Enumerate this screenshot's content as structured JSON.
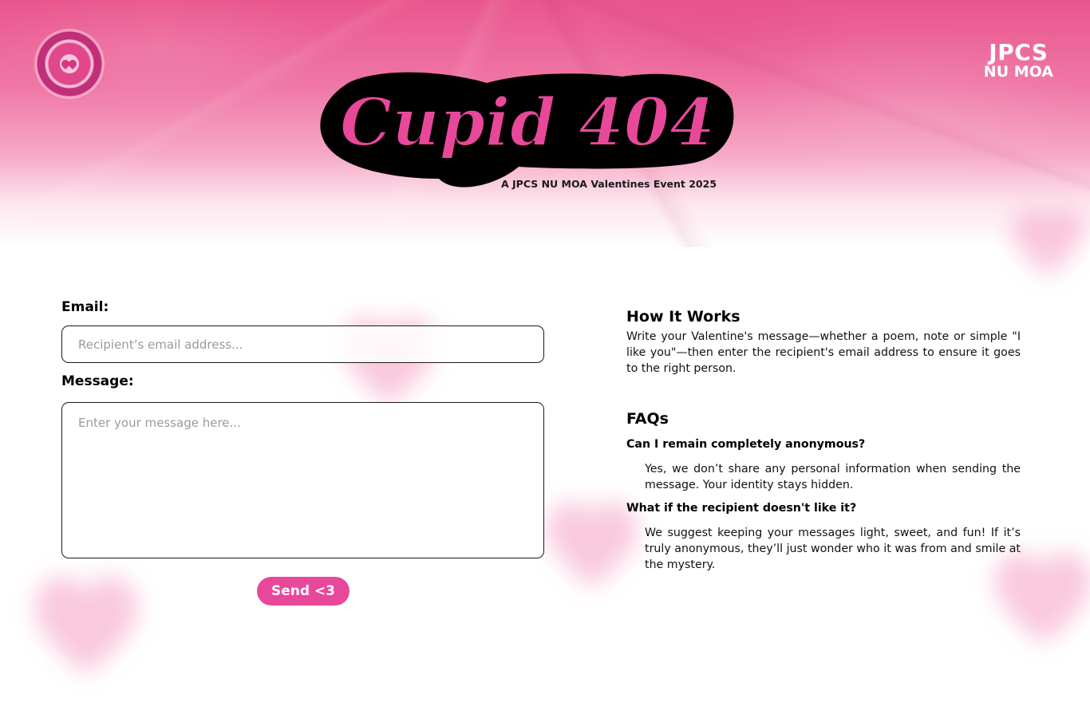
{
  "header": {
    "brand_line1": "JPCS",
    "brand_line2": "NU MOA",
    "title": "Cupid 404",
    "subtitle": "A JPCS NU MOA Valentines Event 2025"
  },
  "form": {
    "email_label": "Email:",
    "email_placeholder": "Recipient’s email address...",
    "message_label": "Message:",
    "message_placeholder": "Enter your message here...",
    "send_label": "Send <3"
  },
  "how_it_works": {
    "heading": "How It Works",
    "text": "Write your Valentine's message—whether a poem, note or simple \"I like you\"—then enter the recipient's email address to ensure it goes to the right person."
  },
  "faqs": {
    "heading": "FAQs",
    "items": [
      {
        "question": "Can I remain completely anonymous?",
        "answer": "Yes, we don’t share any personal information when sending the message. Your identity stays hidden."
      },
      {
        "question": "What if the recipient doesn't like it?",
        "answer": "We suggest keeping your messages light, sweet, and fun! If it’s truly anonymous, they’ll just wonder who it was from and smile at the mystery."
      }
    ]
  },
  "colors": {
    "accent": "#e8489a",
    "title_fill": "#e8489a",
    "title_outline": "#000000",
    "header_pink": "#e9568d"
  }
}
